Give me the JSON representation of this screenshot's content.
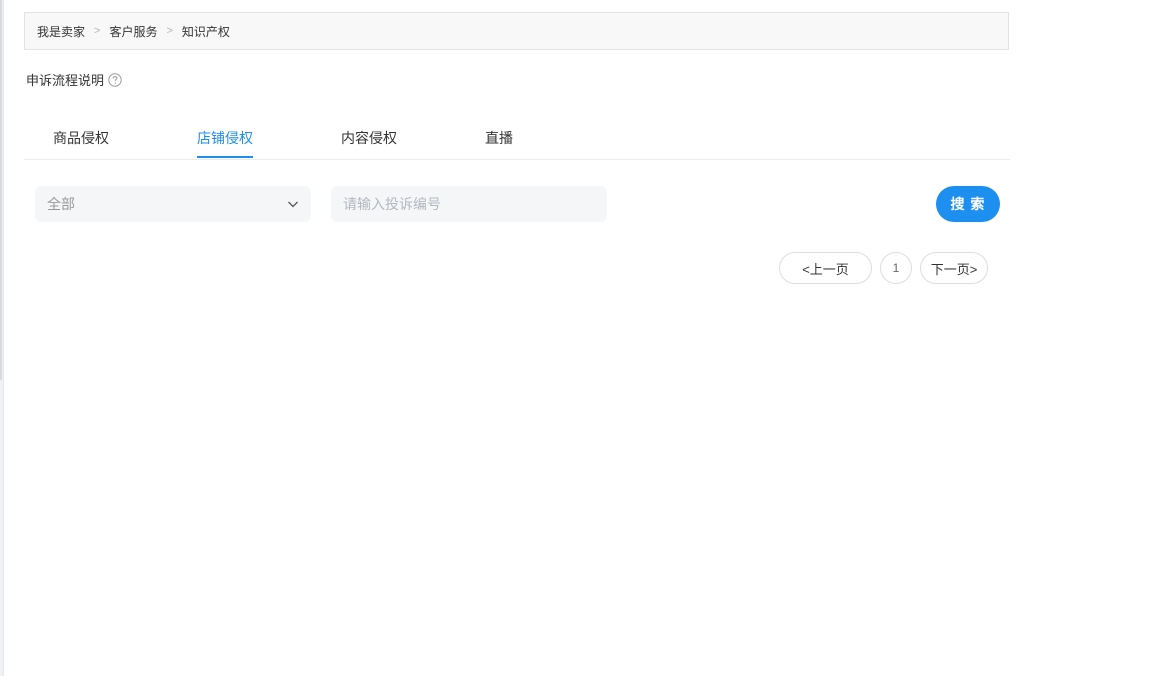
{
  "breadcrumb": {
    "items": [
      "我是卖家",
      "客户服务",
      "知识产权"
    ],
    "separator": ">"
  },
  "process": {
    "label": "申诉流程说明",
    "icon": "question-circle-icon"
  },
  "tabs": [
    {
      "label": "商品侵权",
      "active": false
    },
    {
      "label": "店铺侵权",
      "active": true
    },
    {
      "label": "内容侵权",
      "active": false
    },
    {
      "label": "直播",
      "active": false
    }
  ],
  "filter": {
    "select_value": "全部",
    "search_placeholder": "请输入投诉编号",
    "search_value": "",
    "search_label": "搜 索"
  },
  "pagination": {
    "prev_label": "<上一页",
    "current_page": "1",
    "next_label": "下一页>"
  },
  "colors": {
    "accent": "#1d8ff0",
    "breadcrumb_bg": "#f8f8f8",
    "input_bg": "#f5f6f8"
  }
}
